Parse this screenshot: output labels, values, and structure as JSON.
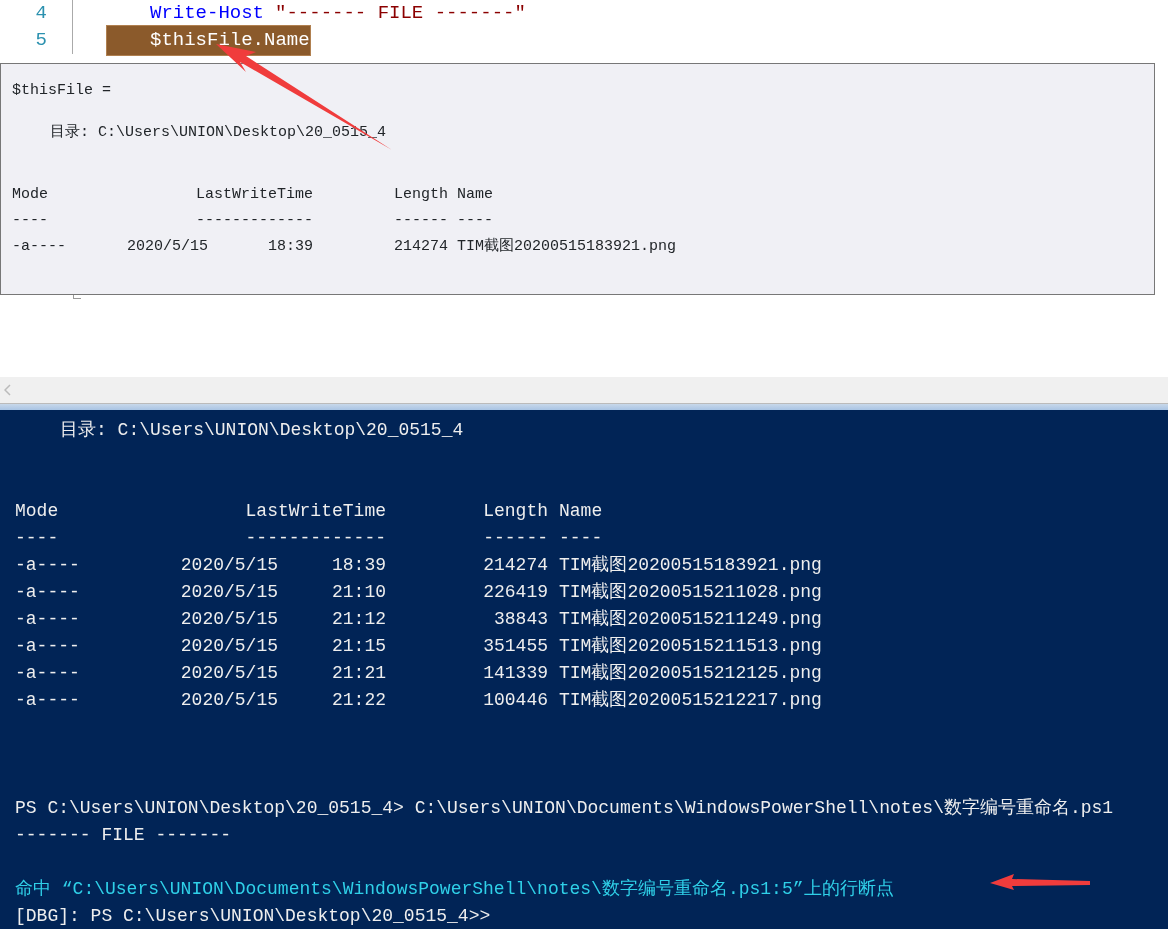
{
  "editor": {
    "lines": [
      {
        "number": "4",
        "highlighted": false,
        "tokens": [
          {
            "kind": "cmdlet",
            "text": "Write-Host"
          },
          {
            "kind": "string",
            "text": "\"------- FILE -------\""
          }
        ]
      },
      {
        "number": "5",
        "highlighted": true,
        "tokens": [
          {
            "kind": "variable",
            "text": "$thisFile.Name"
          }
        ]
      }
    ]
  },
  "tooltip": {
    "header": "$thisFile =",
    "directory": "目录: C:\\Users\\UNION\\Desktop\\20_0515_4",
    "columns": {
      "mode": "Mode",
      "time": "LastWriteTime",
      "length": "Length",
      "name": "Name"
    },
    "rules": {
      "mode": "----",
      "time": "-------------",
      "length": "------",
      "name": "----"
    },
    "rows": [
      {
        "mode": "-a----",
        "date": "2020/5/15",
        "time": "18:39",
        "length": "214274",
        "name": "TIM截图20200515183921.png"
      }
    ]
  },
  "console": {
    "directory": "目录: C:\\Users\\UNION\\Desktop\\20_0515_4",
    "columns": {
      "mode": "Mode",
      "time": "LastWriteTime",
      "length": "Length",
      "name": "Name"
    },
    "rules": {
      "mode": "----",
      "time": "-------------",
      "length": "------",
      "name": "----"
    },
    "rows": [
      {
        "mode": "-a----",
        "date": "2020/5/15",
        "time": "18:39",
        "length": "214274",
        "name": "TIM截图20200515183921.png"
      },
      {
        "mode": "-a----",
        "date": "2020/5/15",
        "time": "21:10",
        "length": "226419",
        "name": "TIM截图20200515211028.png"
      },
      {
        "mode": "-a----",
        "date": "2020/5/15",
        "time": "21:12",
        "length": "38843",
        "name": "TIM截图20200515211249.png"
      },
      {
        "mode": "-a----",
        "date": "2020/5/15",
        "time": "21:15",
        "length": "351455",
        "name": "TIM截图20200515211513.png"
      },
      {
        "mode": "-a----",
        "date": "2020/5/15",
        "time": "21:21",
        "length": "141339",
        "name": "TIM截图20200515212125.png"
      },
      {
        "mode": "-a----",
        "date": "2020/5/15",
        "time": "21:22",
        "length": "100446",
        "name": "TIM截图20200515212217.png"
      }
    ],
    "lines": [
      {
        "kind": "output",
        "text": "PS C:\\Users\\UNION\\Desktop\\20_0515_4> C:\\Users\\UNION\\Documents\\WindowsPowerShell\\notes\\数字编号重命名.ps1"
      },
      {
        "kind": "output",
        "text": "------- FILE -------"
      },
      {
        "kind": "blank"
      },
      {
        "kind": "debug",
        "text": "命中 “C:\\Users\\UNION\\Documents\\WindowsPowerShell\\notes\\数字编号重命名.ps1:5”上的行断点"
      },
      {
        "kind": "output",
        "text": "[DBG]: PS C:\\Users\\UNION\\Desktop\\20_0515_4>>"
      }
    ]
  }
}
